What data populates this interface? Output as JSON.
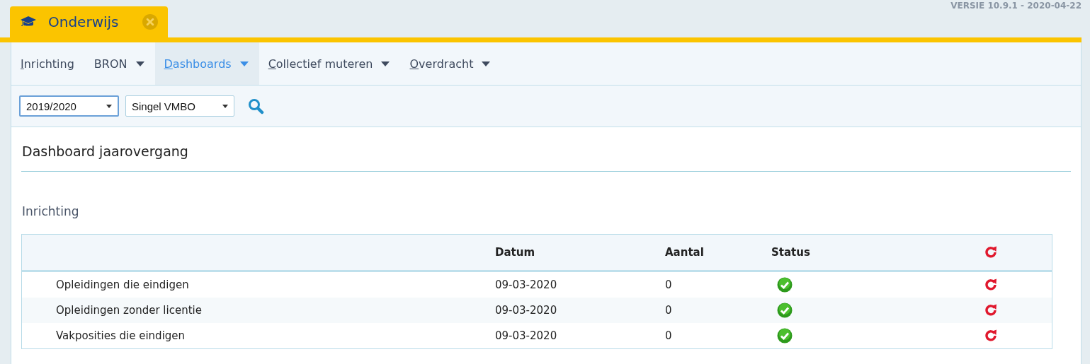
{
  "version": "VERSIE 10.9.1 - 2020-04-22",
  "tab": {
    "title": "Onderwijs",
    "selected": true
  },
  "menu": [
    {
      "label": "Inrichting",
      "dropdown": false,
      "underline_first": true,
      "selected": false
    },
    {
      "label": "BRON",
      "dropdown": true,
      "underline_first": false,
      "selected": false
    },
    {
      "label": "Dashboards",
      "dropdown": true,
      "underline_first": true,
      "selected": true
    },
    {
      "label": "Collectief muteren",
      "dropdown": true,
      "underline_first": true,
      "selected": false
    },
    {
      "label": "Overdracht",
      "dropdown": true,
      "underline_first": true,
      "selected": false
    }
  ],
  "filters": [
    {
      "value": "2019/2020",
      "focused": true
    },
    {
      "value": "Singel VMBO",
      "focused": false
    }
  ],
  "page_title": "Dashboard jaarovergang",
  "section_title": "Inrichting",
  "table": {
    "columns": [
      "Datum",
      "Aantal",
      "Status"
    ],
    "rows": [
      {
        "name": "Opleidingen die eindigen",
        "datum": "09-03-2020",
        "aantal": "0",
        "done": true
      },
      {
        "name": "Opleidingen zonder licentie",
        "datum": "09-03-2020",
        "aantal": "0",
        "done": true
      },
      {
        "name": "Vakposities die eindigen",
        "datum": "09-03-2020",
        "aantal": "0",
        "done": true
      }
    ]
  }
}
